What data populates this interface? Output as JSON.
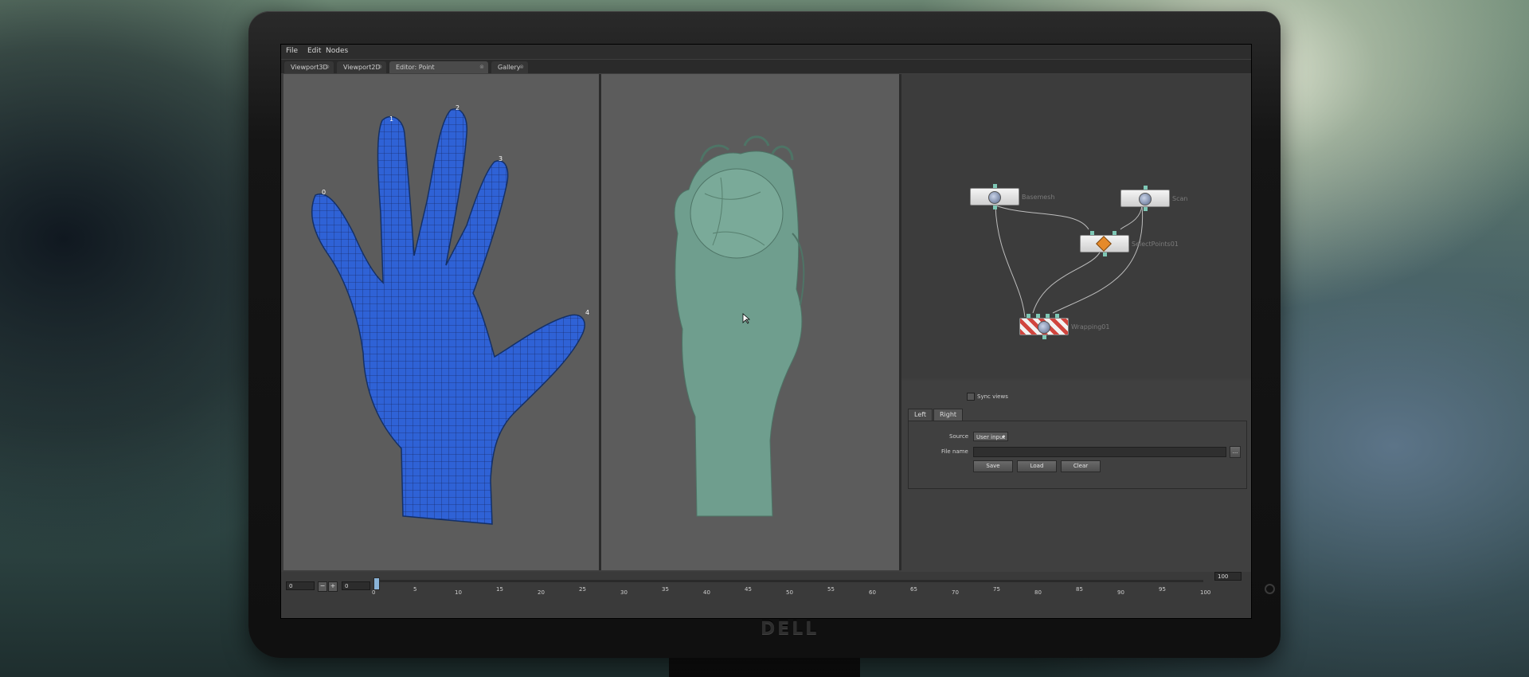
{
  "menu": {
    "items": [
      "File",
      "Edit",
      "Nodes"
    ]
  },
  "tabs": [
    {
      "label": "Viewport3D",
      "close": "⊗"
    },
    {
      "label": "Viewport2D",
      "close": "⊗"
    },
    {
      "label": "Editor: Point correspondences",
      "close": "⊗"
    },
    {
      "label": "Gallery",
      "close": "⊗"
    }
  ],
  "viewport_left": {
    "markers": [
      "0",
      "1",
      "2",
      "3",
      "4"
    ]
  },
  "node_graph": {
    "nodes": [
      {
        "label": "Basemesh"
      },
      {
        "label": "Scan"
      },
      {
        "label": "SelectPoints01"
      },
      {
        "label": "Wrapping01"
      }
    ]
  },
  "properties": {
    "sync_views": "Sync views",
    "tabs": [
      "Left",
      "Right"
    ],
    "source_label": "Source",
    "source_value": "User input",
    "file_name_label": "File name",
    "browse": "...",
    "buttons": {
      "save": "Save",
      "load": "Load",
      "clear": "Clear"
    }
  },
  "timeline": {
    "current_frame": "0",
    "start_frame": "0",
    "end_frame": "100",
    "ticks": [
      "0",
      "5",
      "10",
      "15",
      "20",
      "25",
      "30",
      "35",
      "40",
      "45",
      "50",
      "55",
      "60",
      "65",
      "70",
      "75",
      "80",
      "85",
      "90",
      "95",
      "100"
    ],
    "minus": "−",
    "plus": "+"
  },
  "monitor": {
    "brand": "DELL"
  },
  "colors": {
    "mesh": "#2f62d6",
    "scan": "#6f9e8e",
    "viewport_bg": "#5c5c5c"
  }
}
